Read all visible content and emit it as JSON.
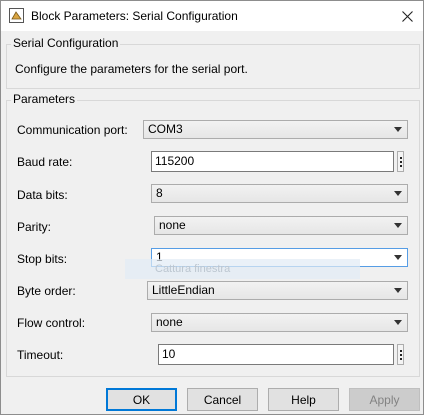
{
  "window": {
    "title": "Block Parameters: Serial Configuration"
  },
  "header_group": {
    "legend": "Serial Configuration",
    "description": "Configure the parameters for the serial port."
  },
  "params_group": {
    "legend": "Parameters"
  },
  "fields": {
    "comm_port": {
      "label": "Communication port:",
      "value": "COM3"
    },
    "baud_rate": {
      "label": "Baud rate:",
      "value": "115200"
    },
    "data_bits": {
      "label": "Data bits:",
      "value": "8"
    },
    "parity": {
      "label": "Parity:",
      "value": "none"
    },
    "stop_bits": {
      "label": "Stop bits:",
      "value": "1"
    },
    "byte_order": {
      "label": "Byte order:",
      "value": "LittleEndian"
    },
    "flow_control": {
      "label": "Flow control:",
      "value": "none"
    },
    "timeout": {
      "label": "Timeout:",
      "value": "10"
    }
  },
  "ghost_text": "Cattura finestra",
  "buttons": {
    "ok": "OK",
    "cancel": "Cancel",
    "help": "Help",
    "apply": "Apply"
  }
}
